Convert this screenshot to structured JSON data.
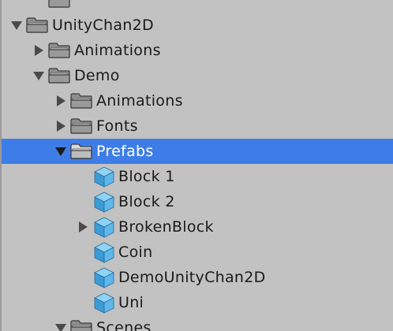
{
  "colors": {
    "panel_bg": "#c2c2c2",
    "selected_bg": "#3e7de7",
    "text": "#1a1a1a",
    "selected_text": "#ffffff",
    "cube": "#4aa8e0"
  },
  "tree": {
    "items": [
      {
        "label": "",
        "icon": "folder-icon",
        "arrow": "none",
        "depth": 1,
        "partial": true
      },
      {
        "label": "UnityChan2D",
        "icon": "folder-icon",
        "arrow": "expanded",
        "depth": 0
      },
      {
        "label": "Animations",
        "icon": "folder-icon",
        "arrow": "collapsed",
        "depth": 1
      },
      {
        "label": "Demo",
        "icon": "folder-icon",
        "arrow": "expanded",
        "depth": 1
      },
      {
        "label": "Animations",
        "icon": "folder-icon",
        "arrow": "collapsed",
        "depth": 2
      },
      {
        "label": "Fonts",
        "icon": "folder-icon",
        "arrow": "collapsed",
        "depth": 2
      },
      {
        "label": "Prefabs",
        "icon": "folder-icon",
        "arrow": "expanded",
        "depth": 2,
        "selected": true
      },
      {
        "label": "Block 1",
        "icon": "prefab-cube-icon",
        "arrow": "none",
        "depth": 3
      },
      {
        "label": "Block 2",
        "icon": "prefab-cube-icon",
        "arrow": "none",
        "depth": 3
      },
      {
        "label": "BrokenBlock",
        "icon": "prefab-cube-icon",
        "arrow": "collapsed",
        "depth": 3
      },
      {
        "label": "Coin",
        "icon": "prefab-cube-icon",
        "arrow": "none",
        "depth": 3
      },
      {
        "label": "DemoUnityChan2D",
        "icon": "prefab-cube-icon",
        "arrow": "none",
        "depth": 3
      },
      {
        "label": "Uni",
        "icon": "prefab-cube-icon",
        "arrow": "none",
        "depth": 3
      },
      {
        "label": "Scenes",
        "icon": "folder-icon",
        "arrow": "expanded",
        "depth": 2
      }
    ]
  }
}
